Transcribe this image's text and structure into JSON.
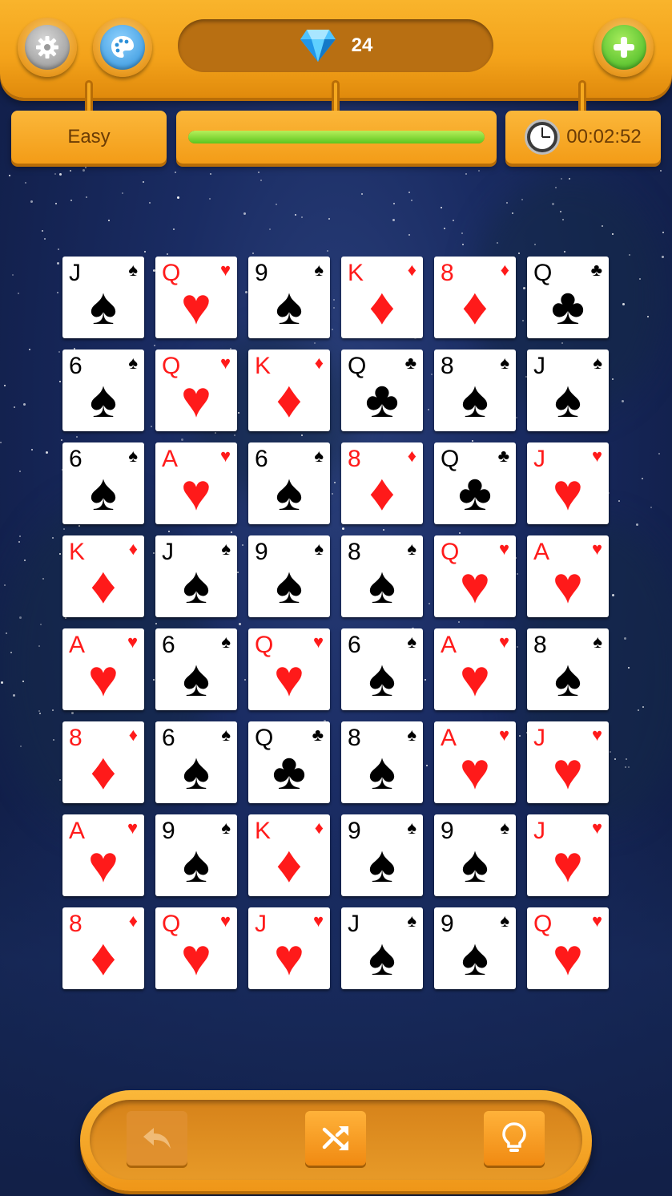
{
  "header": {
    "settings_icon": "gear-icon",
    "theme_icon": "palette-icon",
    "gems": "24",
    "gem_icon": "diamond-icon",
    "add_icon": "plus-icon"
  },
  "status": {
    "difficulty": "Easy",
    "progress": 1.0,
    "timer": "00:02:52"
  },
  "board": {
    "rows": [
      [
        [
          "J",
          "♠"
        ],
        [
          "Q",
          "♥"
        ],
        [
          "9",
          "♠"
        ],
        [
          "K",
          "♦"
        ],
        [
          "8",
          "♦"
        ],
        [
          "Q",
          "♣"
        ]
      ],
      [
        [
          "6",
          "♠"
        ],
        [
          "Q",
          "♥"
        ],
        [
          "K",
          "♦"
        ],
        [
          "Q",
          "♣"
        ],
        [
          "8",
          "♠"
        ],
        [
          "J",
          "♠"
        ]
      ],
      [
        [
          "6",
          "♠"
        ],
        [
          "A",
          "♥"
        ],
        [
          "6",
          "♠"
        ],
        [
          "8",
          "♦"
        ],
        [
          "Q",
          "♣"
        ],
        [
          "J",
          "♥"
        ]
      ],
      [
        [
          "K",
          "♦"
        ],
        [
          "J",
          "♠"
        ],
        [
          "9",
          "♠"
        ],
        [
          "8",
          "♠"
        ],
        [
          "Q",
          "♥"
        ],
        [
          "A",
          "♥"
        ]
      ],
      [
        [
          "A",
          "♥"
        ],
        [
          "6",
          "♠"
        ],
        [
          "Q",
          "♥"
        ],
        [
          "6",
          "♠"
        ],
        [
          "A",
          "♥"
        ],
        [
          "8",
          "♠"
        ]
      ],
      [
        [
          "8",
          "♦"
        ],
        [
          "6",
          "♠"
        ],
        [
          "Q",
          "♣"
        ],
        [
          "8",
          "♠"
        ],
        [
          "A",
          "♥"
        ],
        [
          "J",
          "♥"
        ]
      ],
      [
        [
          "A",
          "♥"
        ],
        [
          "9",
          "♠"
        ],
        [
          "K",
          "♦"
        ],
        [
          "9",
          "♠"
        ],
        [
          "9",
          "♠"
        ],
        [
          "J",
          "♥"
        ]
      ],
      [
        [
          "8",
          "♦"
        ],
        [
          "Q",
          "♥"
        ],
        [
          "J",
          "♥"
        ],
        [
          "J",
          "♠"
        ],
        [
          "9",
          "♠"
        ],
        [
          "Q",
          "♥"
        ]
      ]
    ]
  },
  "toolbar": {
    "undo_icon": "undo-icon",
    "shuffle_icon": "shuffle-icon",
    "hint_icon": "lightbulb-icon"
  },
  "colors": {
    "orange": "#f3a21a",
    "red_suit": "#ff1a1a",
    "black_suit": "#000000",
    "progress_green": "#5cc51f"
  }
}
